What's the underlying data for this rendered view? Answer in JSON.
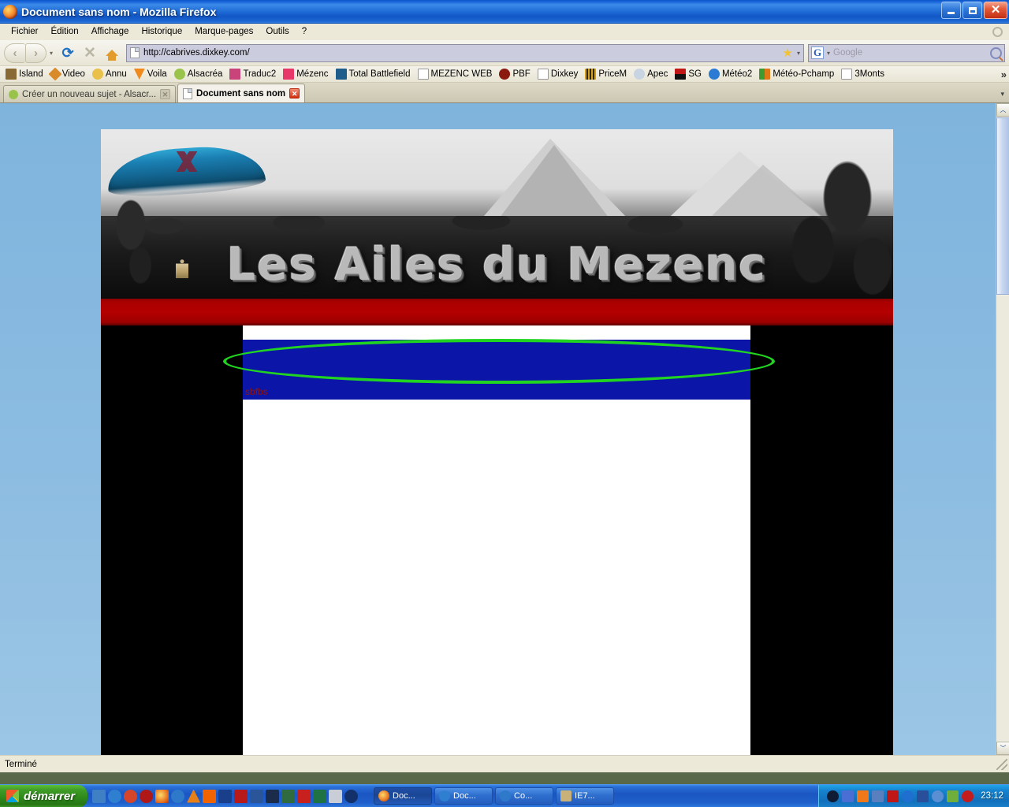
{
  "window": {
    "title": "Document sans nom - Mozilla Firefox",
    "app_icon": "firefox-icon",
    "minimize_label": "",
    "maximize_label": "",
    "close_label": "✕"
  },
  "menu": {
    "items": [
      {
        "label": "Fichier",
        "accel": "F"
      },
      {
        "label": "Édition",
        "accel": "n"
      },
      {
        "label": "Affichage",
        "accel": "A"
      },
      {
        "label": "Historique",
        "accel": "H"
      },
      {
        "label": "Marque-pages",
        "accel": "M"
      },
      {
        "label": "Outils",
        "accel": "O"
      },
      {
        "label": "?",
        "accel": "?"
      }
    ]
  },
  "toolbar": {
    "back_glyph": "‹",
    "forward_glyph": "›",
    "history_caret": "▾",
    "reload_glyph": "⟳",
    "stop_glyph": "✕",
    "home_name": "home-icon",
    "url": "http://cabrives.dixkey.com/",
    "url_placeholder": "",
    "star_glyph": "★",
    "url_caret": "▾",
    "search_engine": "G",
    "search_caret": "▾",
    "search_placeholder": "Google",
    "search_value": ""
  },
  "bookmarks": {
    "overflow_glyph": "»",
    "items": [
      {
        "label": "Island",
        "color": "#8a6a34"
      },
      {
        "label": "Video",
        "color": "#d98b2b"
      },
      {
        "label": "Annu",
        "color": "#e8c04a"
      },
      {
        "label": "Voila",
        "color": "#f08a1c"
      },
      {
        "label": "Alsacréa",
        "color": "#9ac34b"
      },
      {
        "label": "Traduc2",
        "color": "#c8447a"
      },
      {
        "label": "Mézenc",
        "color": "#e8386a"
      },
      {
        "label": "Total Battlefield",
        "color": "#1f5d8a"
      },
      {
        "label": "MEZENC WEB",
        "color": "#ffffff"
      },
      {
        "label": "PBF",
        "color": "#8a1a10"
      },
      {
        "label": "Dixkey",
        "color": "#ffffff"
      },
      {
        "label": "PriceM",
        "color": "#d8a018"
      },
      {
        "label": "Apec",
        "color": "#c9d4e2"
      },
      {
        "label": "SG",
        "color": "#c01616"
      },
      {
        "label": "Météo2",
        "color": "#2b7ad4"
      },
      {
        "label": "Météo-Pchamp",
        "color": "#3f9a2f"
      },
      {
        "label": "3Monts",
        "color": "#ffffff"
      }
    ]
  },
  "tabs": {
    "overflow_caret": "▾",
    "close_glyph": "✕",
    "items": [
      {
        "label": "Créer un nouveau sujet - Alsacr...",
        "active": false
      },
      {
        "label": "Document sans nom",
        "active": true
      }
    ]
  },
  "page": {
    "banner_title": "Les Ailes du Mezenc",
    "banner_alt": "paraglider-over-mezenc-mountain",
    "blue_block_text": "sbfbs",
    "colors": {
      "red_bar": "#b40000",
      "blue_block": "#0b16a8",
      "sidebar": "#000000",
      "content": "#ffffff",
      "annotation": "#22d422",
      "blue_text": "#8c1616"
    },
    "annotation_shape": "ellipse"
  },
  "scrollbar": {
    "up_glyph": "︿",
    "down_glyph": "﹀"
  },
  "status": {
    "text": "Terminé"
  },
  "taskbar": {
    "start_label": "démarrer",
    "clock": "23:12",
    "quick_launch": [
      {
        "name": "show-desktop-icon",
        "color": "#3f7fc4"
      },
      {
        "name": "internet-explorer-icon",
        "color": "#2f7fd0"
      },
      {
        "name": "media-player-icon",
        "color": "#d4452a"
      },
      {
        "name": "opera-icon",
        "color": "#b01818"
      },
      {
        "name": "firefox-icon",
        "color": "#e87722"
      },
      {
        "name": "outlook-express-icon",
        "color": "#2e79c9"
      },
      {
        "name": "vlc-icon",
        "color": "#e8801a"
      },
      {
        "name": "orange-icon",
        "color": "#f06400"
      },
      {
        "name": "antivirus-icon",
        "color": "#1a3f8a"
      },
      {
        "name": "acrobat-icon",
        "color": "#b81a1a"
      },
      {
        "name": "word-icon",
        "color": "#2a5699"
      },
      {
        "name": "photoshop-icon",
        "color": "#1a2c4a"
      },
      {
        "name": "dreamweaver-icon",
        "color": "#2f6b3f"
      },
      {
        "name": "flash-icon",
        "color": "#c8201c"
      },
      {
        "name": "excel-icon",
        "color": "#1f7244"
      },
      {
        "name": "notepad-icon",
        "color": "#c8cdd6"
      },
      {
        "name": "moon-icon",
        "color": "#13306b"
      }
    ],
    "tasks": [
      {
        "label": "Doc...",
        "icon": "firefox-icon",
        "color": "#e87722",
        "active": true
      },
      {
        "label": "Doc...",
        "icon": "internet-explorer-icon",
        "color": "#2f7fd0",
        "active": false
      },
      {
        "label": "Co...",
        "icon": "outlook-express-icon",
        "color": "#2e79c9",
        "active": false
      },
      {
        "label": "IE7...",
        "icon": "setup-icon",
        "color": "#c9b27a",
        "active": false
      }
    ],
    "tray": [
      {
        "name": "moon-icon",
        "color": "#101b34"
      },
      {
        "name": "network-icon",
        "color": "#4a6fd4"
      },
      {
        "name": "monitor-icon",
        "color": "#f07818"
      },
      {
        "name": "shield-icon",
        "color": "#5a7fbf"
      },
      {
        "name": "disconnect-icon",
        "color": "#c01616"
      },
      {
        "name": "info-icon",
        "color": "#1f6fd0"
      },
      {
        "name": "amazon-icon",
        "color": "#2a4f9a"
      },
      {
        "name": "update-icon",
        "color": "#5a8fd4"
      },
      {
        "name": "printer-icon",
        "color": "#6fae3a"
      },
      {
        "name": "alert-icon",
        "color": "#c41c1c"
      }
    ]
  }
}
